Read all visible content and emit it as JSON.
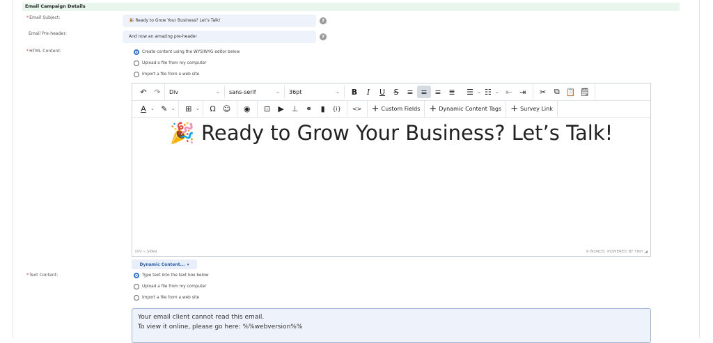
{
  "section": {
    "title": "Email Campaign Details"
  },
  "subject": {
    "label": "Email Subject:",
    "required": "*",
    "value": "🎉 Ready to Grow Your Business? Let’s Talk!",
    "help": "?"
  },
  "preheader": {
    "label": "Email Pre-header:",
    "value": "And now an amazing pre-header",
    "help": "?"
  },
  "html_content": {
    "label": "HTML Content:",
    "required": "*",
    "options": [
      {
        "label": "Create content using the WYSIWYG editor below",
        "selected": true
      },
      {
        "label": "Upload a file from my computer",
        "selected": false
      },
      {
        "label": "Import a file from a web site",
        "selected": false
      }
    ]
  },
  "toolbar": {
    "block_format": "Div",
    "font_family": "sans-serif",
    "font_size": "36pt",
    "custom_fields": "Custom Fields",
    "dynamic_tags": "Dynamic Content Tags",
    "survey_link": "Survey Link"
  },
  "editor": {
    "heading": "🎉 Ready to Grow Your Business? Let’s Talk!",
    "path": "DIV » SPAN",
    "word_count": "9 WORDS",
    "powered": "POWERED BY TINY"
  },
  "dynamic_content_button": {
    "label": "Dynamic Content..."
  },
  "text_content": {
    "label": "Text Content:",
    "required": "*",
    "options": [
      {
        "label": "Type text into the text box below",
        "selected": true
      },
      {
        "label": "Upload a file from my computer",
        "selected": false
      },
      {
        "label": "Import a file from a web site",
        "selected": false
      }
    ],
    "line1": "Your email client cannot read this email.",
    "line2": "To view it online, please go here: %%webversion%%"
  }
}
